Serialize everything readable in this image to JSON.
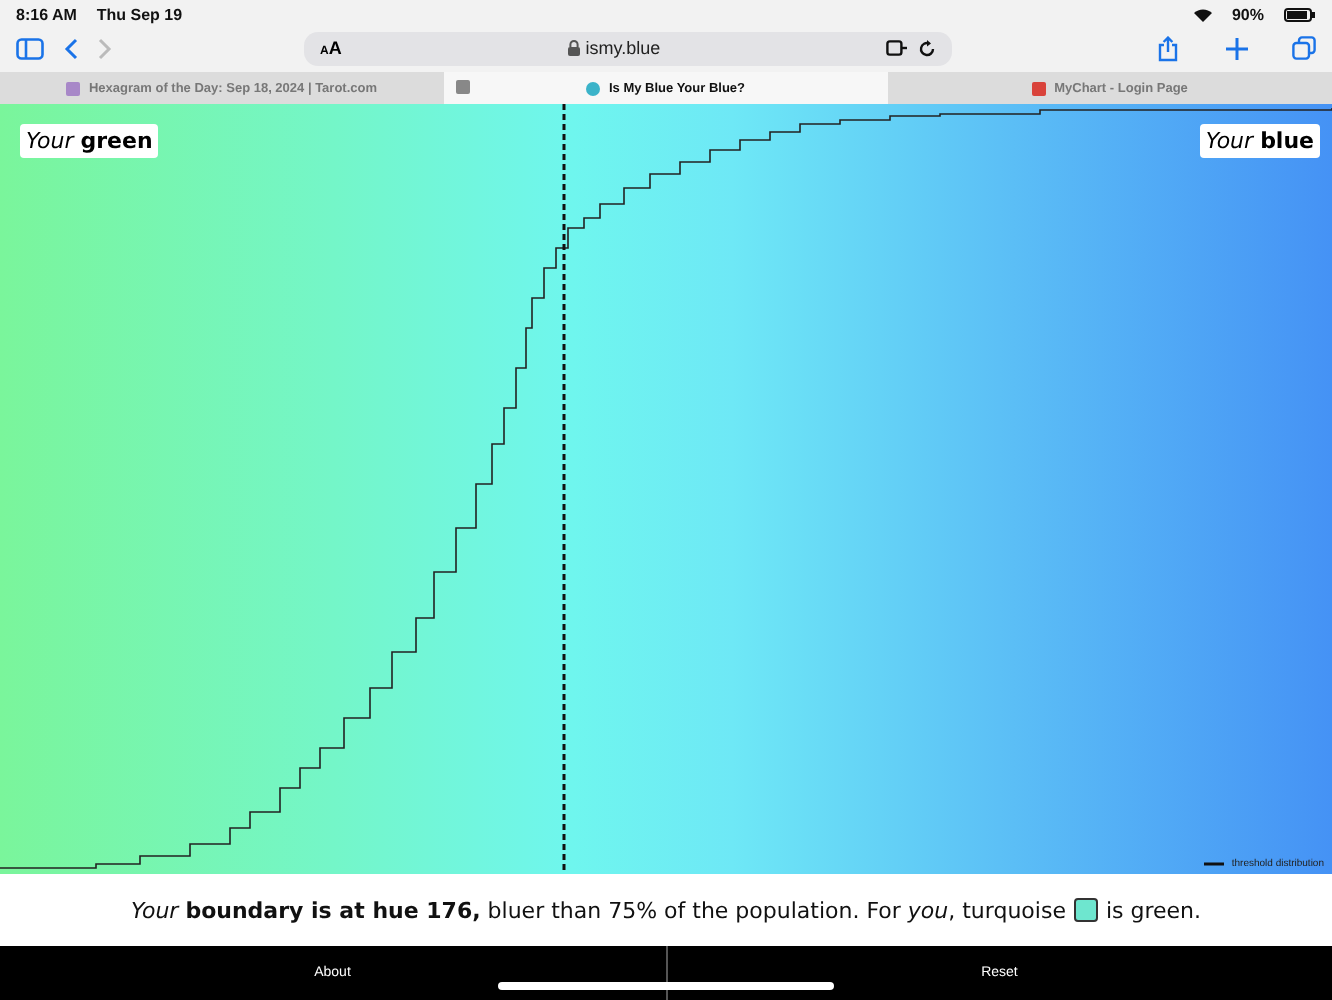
{
  "status_bar": {
    "time": "8:16 AM",
    "date": "Thu Sep 19",
    "battery": "90%"
  },
  "toolbar": {
    "reader_label": "AA",
    "url": "ismy.blue"
  },
  "tabs": [
    {
      "title": "Hexagram of the Day: Sep 18, 2024 | Tarot.com",
      "selected": false
    },
    {
      "title": "Is My Blue Your Blue?",
      "selected": true
    },
    {
      "title": "MyChart - Login Page",
      "selected": false
    }
  ],
  "chart": {
    "left_label": "*Your* **green**",
    "right_label": "*Your* **blue**",
    "legend": "threshold distribution"
  },
  "sentence": {
    "start": "*Your* **boundary is at hue 176,** bluer than 75% of the population. For *you*, turquoise",
    "end": "is green."
  },
  "bottom_buttons": [
    "About",
    "Reset"
  ]
}
